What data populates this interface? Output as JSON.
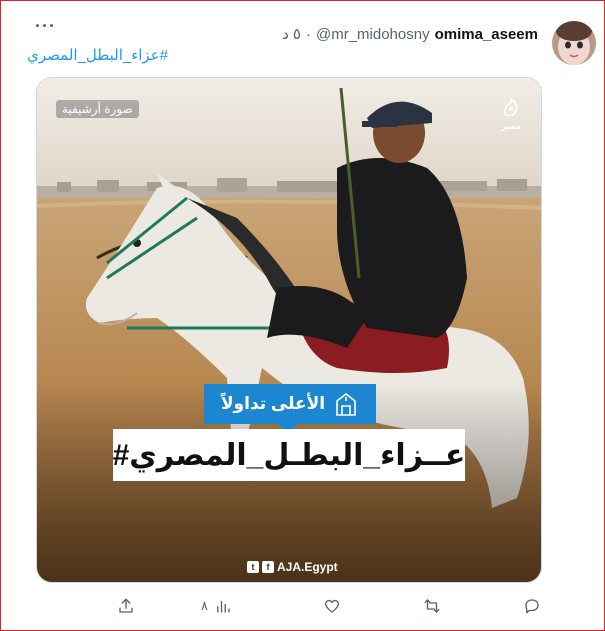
{
  "tweet": {
    "display_name": "omima_aseem",
    "handle": "@mr_midohosny",
    "separator": "·",
    "time": "٥ د",
    "more_label": "···",
    "hashtag": "#عزاء_البطل_المصري"
  },
  "media": {
    "archive_label": "صورة أرشيفية",
    "trend_label": "الأعلى تداولاً",
    "hashtag_text": "#عــزاء_البطـل_المصري",
    "brand_handle": "AJA.Egypt",
    "logo_text": "مصر"
  },
  "actions": {
    "views_count": "٨"
  },
  "colors": {
    "accent": "#1d9bf0",
    "trend_badge": "#1c86d1",
    "frame_border": "#d62828",
    "muted": "#536471"
  }
}
